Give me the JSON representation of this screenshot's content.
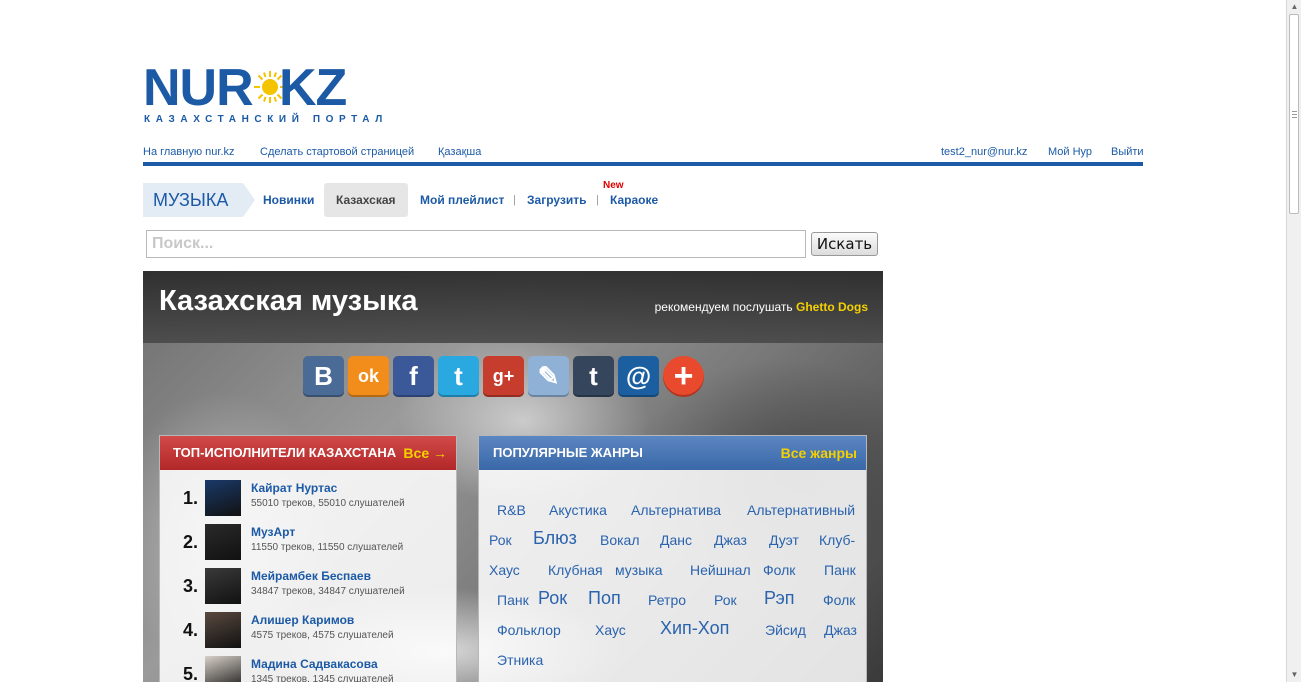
{
  "logo": {
    "word_left": "NUR",
    "word_right": "KZ",
    "tagline": "КАЗАХСТАНСКИЙ ПОРТАЛ",
    "sun_color": "#f5c400"
  },
  "topbar": {
    "links_left": [
      "На главную nur.kz",
      "Сделать стартовой страницей",
      "Қазақша"
    ],
    "links_right": [
      "test2_nur@nur.kz",
      "Мой Нур",
      "Выйти"
    ],
    "accent_color": "#1c5aa6"
  },
  "nav": {
    "section": "МУЗЫКА",
    "items": [
      "Новинки",
      "Казахская",
      "Мой плейлист",
      "Загрузить",
      "Караоке"
    ],
    "active_item": "Казахская",
    "separator": "|",
    "new_badge": "New"
  },
  "search": {
    "placeholder": "Поиск...",
    "value": "",
    "button": "Искать"
  },
  "hero": {
    "title": "Казахская музыка",
    "recommend_text": "рекомендуем послушать",
    "recommend_artist": "Ghetto Dogs"
  },
  "share": [
    {
      "icon": "vk-icon",
      "glyph": "В",
      "color": "#4a6b95"
    },
    {
      "icon": "odnoklassniki-icon",
      "glyph": "ok",
      "color": "#f28c1a"
    },
    {
      "icon": "facebook-icon",
      "glyph": "f",
      "color": "#3b5998"
    },
    {
      "icon": "twitter-icon",
      "glyph": "t",
      "color": "#2aa9e0"
    },
    {
      "icon": "google-plus-icon",
      "glyph": "g+",
      "color": "#c63d2d"
    },
    {
      "icon": "livejournal-icon",
      "glyph": "✎",
      "color": "#8fb1d6"
    },
    {
      "icon": "tumblr-icon",
      "glyph": "t",
      "color": "#35465c"
    },
    {
      "icon": "mail-icon",
      "glyph": "@",
      "color": "#1b5fa0"
    },
    {
      "icon": "more-icon",
      "glyph": "+",
      "color": "#e9492d"
    }
  ],
  "top_artists": {
    "heading": "ТОП-ИСПОЛНИТЕЛИ КАЗАХСТАНА",
    "all_link": "Все →",
    "items": [
      {
        "rank": "1.",
        "name": "Кайрат Нуртас",
        "stats": "55010 треков, 55010 слушателей"
      },
      {
        "rank": "2.",
        "name": "МузАрт",
        "stats": "11550 треков, 11550 слушателей"
      },
      {
        "rank": "3.",
        "name": "Мейрамбек Беспаев",
        "stats": "34847 треков, 34847 слушателей"
      },
      {
        "rank": "4.",
        "name": "Алишер Каримов",
        "stats": "4575 треков, 4575 слушателей"
      },
      {
        "rank": "5.",
        "name": "Мадина Садвакасова",
        "stats": "1345 треков, 1345 слушателей"
      }
    ]
  },
  "genres": {
    "heading": "ПОПУЛЯРНЫЕ ЖАНРЫ",
    "all_link": "Все жанры",
    "items": [
      "R&B",
      "Акустика",
      "Альтернатива",
      "Альтернативный",
      "Рок",
      "Блюз",
      "Вокал",
      "Данс",
      "Джаз",
      "Дуэт",
      "Клуб-",
      "Хаус",
      "Клубная",
      "музыка",
      "Нейшнал",
      "Фолк",
      "Панк",
      "Панк",
      "Рок",
      "Поп",
      "Ретро",
      "Рок",
      "Рэп",
      "Фолк",
      "Фольклор",
      "Хаус",
      "Хип-Хоп",
      "Эйсид",
      "Джаз",
      "Этника"
    ]
  }
}
